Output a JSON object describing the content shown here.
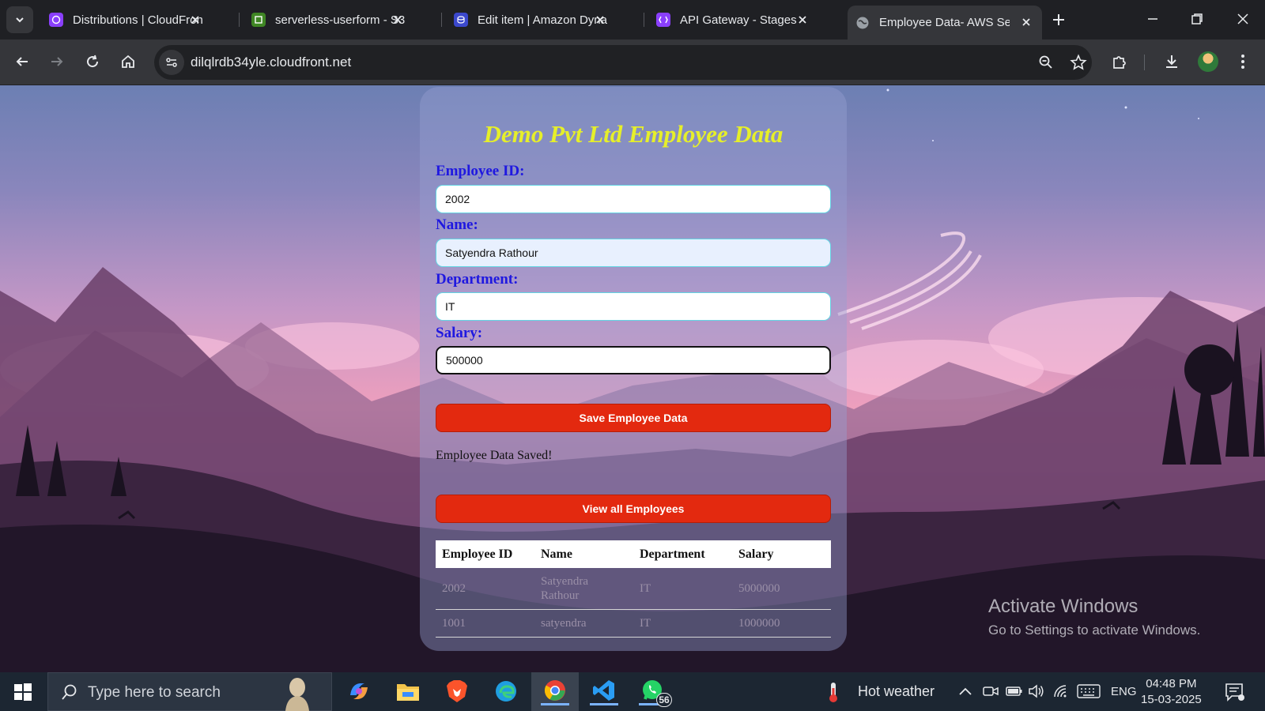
{
  "browser": {
    "tabs": [
      {
        "label": "Distributions | CloudFront",
        "icon": "cloudfront-icon"
      },
      {
        "label": "serverless-userform - S3",
        "icon": "s3-icon"
      },
      {
        "label": "Edit item | Amazon DynamoDB",
        "icon": "dynamodb-icon"
      },
      {
        "label": "API Gateway - Stages",
        "icon": "api-gateway-icon"
      },
      {
        "label": "Employee Data- AWS Serverless",
        "icon": "globe-icon",
        "active": true
      }
    ],
    "url": "dilqlrdb34yle.cloudfront.net"
  },
  "form": {
    "title": "Demo Pvt Ltd Employee Data",
    "employee_id": {
      "label": "Employee ID:",
      "value": "2002"
    },
    "name": {
      "label": "Name:",
      "value": "Satyendra Rathour"
    },
    "department": {
      "label": "Department:",
      "value": "IT"
    },
    "salary": {
      "label": "Salary:",
      "value": "500000"
    },
    "save_label": "Save Employee Data",
    "status": "Employee Data Saved!",
    "view_label": "View all Employees"
  },
  "table": {
    "headers": [
      "Employee ID",
      "Name",
      "Department",
      "Salary"
    ],
    "rows": [
      [
        "2002",
        "Satyendra Rathour",
        "IT",
        "5000000"
      ],
      [
        "1001",
        "satyendra",
        "IT",
        "1000000"
      ]
    ]
  },
  "watermark": {
    "line1": "Activate Windows",
    "line2": "Go to Settings to activate Windows."
  },
  "taskbar": {
    "search_placeholder": "Type here to search",
    "weather": "Hot weather",
    "lang": "ENG",
    "time": "04:48 PM",
    "date": "15-03-2025",
    "whatsapp_badge": "56"
  },
  "colors": {
    "title": "#e6ef2a",
    "label": "#1f18e0",
    "button": "#e3290f",
    "input_border": "#64d6e4"
  }
}
